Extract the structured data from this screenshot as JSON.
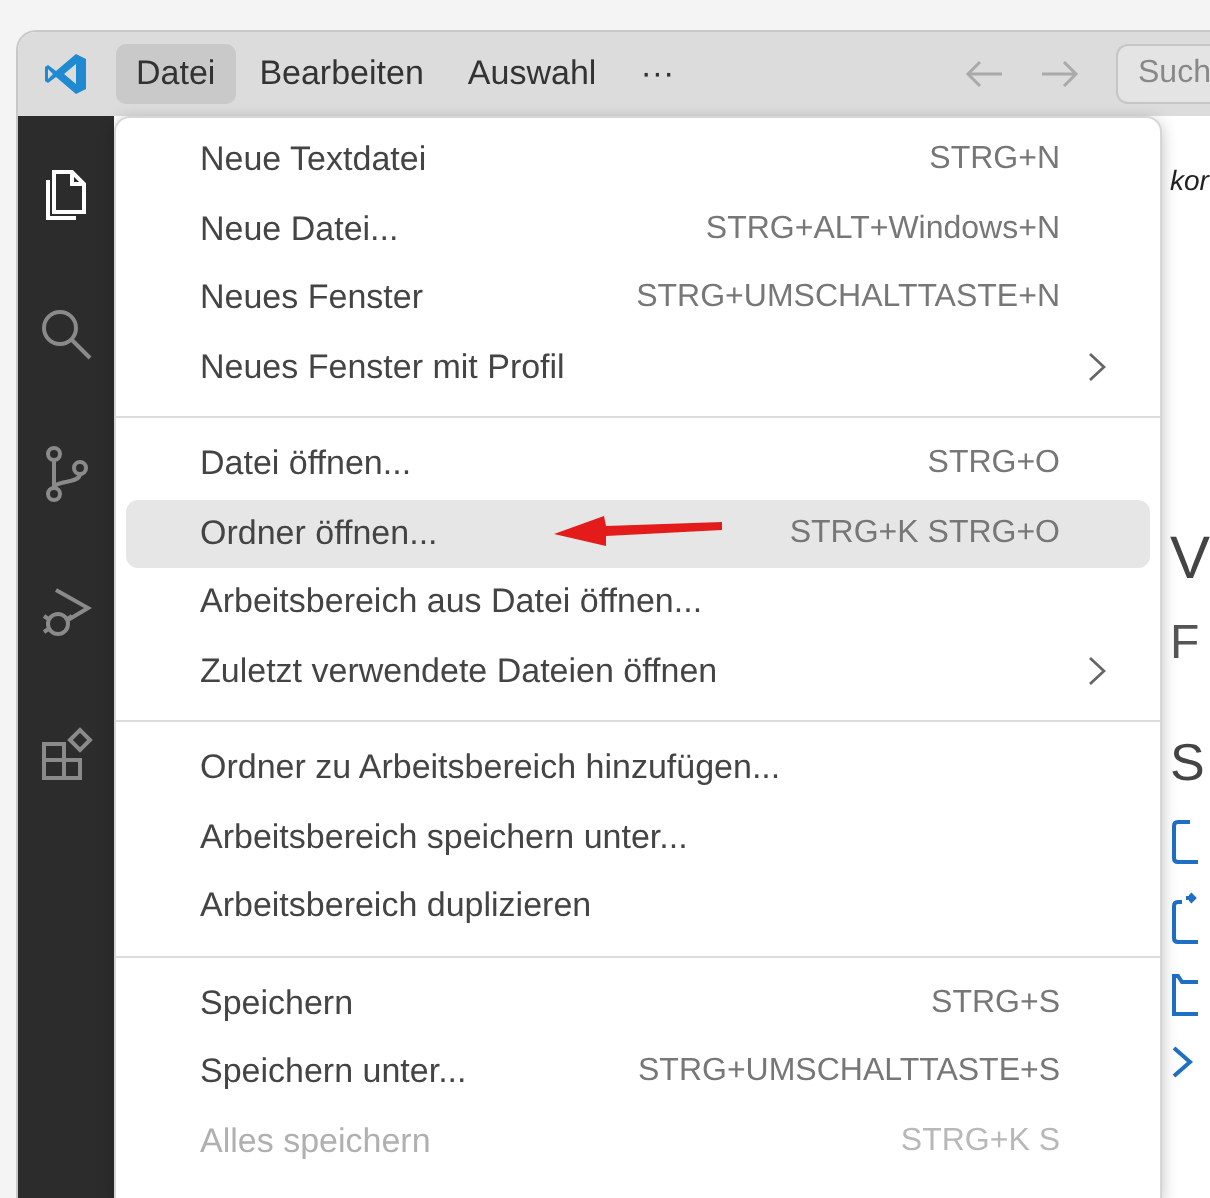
{
  "title_bar": {
    "menus": [
      {
        "label": "Datei",
        "selected": true
      },
      {
        "label": "Bearbeiten",
        "selected": false
      },
      {
        "label": "Auswahl",
        "selected": false
      },
      {
        "label": "···",
        "selected": false
      }
    ],
    "search": {
      "placeholder": "Such"
    }
  },
  "activity_bar": [
    {
      "kind": "files",
      "selected": true
    },
    {
      "kind": "search",
      "selected": false
    },
    {
      "kind": "source-control",
      "selected": false
    },
    {
      "kind": "debug",
      "selected": false
    },
    {
      "kind": "extensions",
      "selected": false
    }
  ],
  "menu": {
    "groups": [
      {
        "items": [
          {
            "label": "Neue Textdatei",
            "shortcut": "STRG+N",
            "submenu": false,
            "selected": false,
            "disabled": false
          },
          {
            "label": "Neue Datei...",
            "shortcut": "STRG+ALT+Windows+N",
            "submenu": false,
            "selected": false,
            "disabled": false
          },
          {
            "label": "Neues Fenster",
            "shortcut": "STRG+UMSCHALTTASTE+N",
            "submenu": false,
            "selected": false,
            "disabled": false
          },
          {
            "label": "Neues Fenster mit Profil",
            "submenu": true,
            "selected": false,
            "disabled": false
          }
        ]
      },
      {
        "items": [
          {
            "label": "Datei öffnen...",
            "shortcut": "STRG+O",
            "submenu": false,
            "selected": false,
            "disabled": false
          },
          {
            "label": "Ordner öffnen...",
            "shortcut": "STRG+K STRG+O",
            "submenu": false,
            "selected": true,
            "disabled": false,
            "arrow": true
          },
          {
            "label": "Arbeitsbereich aus Datei öffnen...",
            "submenu": false,
            "selected": false,
            "disabled": false
          },
          {
            "label": "Zuletzt verwendete Dateien öffnen",
            "submenu": true,
            "selected": false,
            "disabled": false
          }
        ]
      },
      {
        "items": [
          {
            "label": "Ordner zu Arbeitsbereich hinzufügen...",
            "submenu": false,
            "selected": false,
            "disabled": false
          },
          {
            "label": "Arbeitsbereich speichern unter...",
            "submenu": false,
            "selected": false,
            "disabled": false
          },
          {
            "label": "Arbeitsbereich duplizieren",
            "submenu": false,
            "selected": false,
            "disabled": false
          }
        ]
      },
      {
        "items": [
          {
            "label": "Speichern",
            "shortcut": "STRG+S",
            "submenu": false,
            "selected": false,
            "disabled": false
          },
          {
            "label": "Speichern unter...",
            "shortcut": "STRG+UMSCHALTTASTE+S",
            "submenu": false,
            "selected": false,
            "disabled": false
          },
          {
            "label": "Alles speichern",
            "shortcut": "STRG+K S",
            "submenu": false,
            "selected": false,
            "disabled": true
          }
        ]
      }
    ]
  },
  "editor": {
    "texts": [
      {
        "kind": "note",
        "text": "kor"
      },
      {
        "kind": "heading",
        "text": "V"
      },
      {
        "kind": "subtitle",
        "text": "F"
      },
      {
        "kind": "section",
        "text": "S"
      }
    ]
  }
}
